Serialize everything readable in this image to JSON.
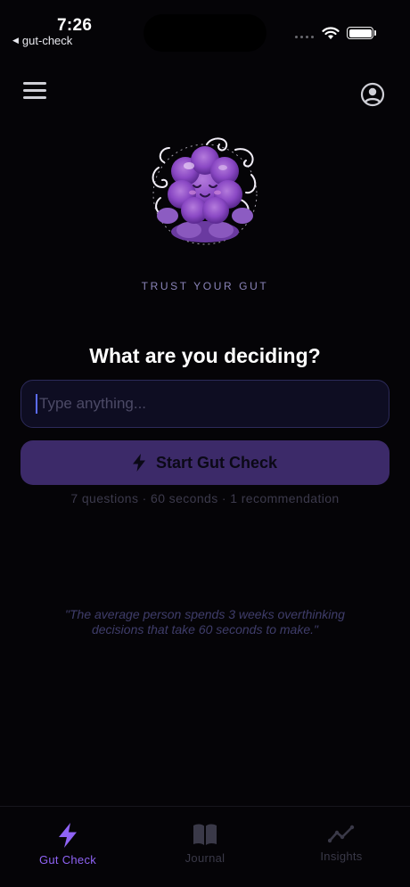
{
  "status_bar": {
    "time": "7:26",
    "back_app": "gut-check"
  },
  "header": {
    "menu_icon": "hamburger-menu-icon",
    "profile_icon": "user-profile-icon"
  },
  "hero": {
    "mascot": "meditating-purple-blob-mascot",
    "tagline": "TRUST YOUR GUT",
    "heading": "What are you deciding?"
  },
  "decision_input": {
    "value": "",
    "placeholder": "Type anything..."
  },
  "start_button": {
    "icon": "lightning-bolt-icon",
    "label": "Start Gut Check"
  },
  "meta": "7 questions · 60 seconds · 1 recommendation",
  "quote": "\"The average person spends 3 weeks overthinking decisions that take 60 seconds to make.\"",
  "tab_bar": {
    "tabs": [
      {
        "label": "Gut Check",
        "icon": "lightning-bolt-icon",
        "active": true
      },
      {
        "label": "Journal",
        "icon": "open-book-icon",
        "active": false
      },
      {
        "label": "Insights",
        "icon": "trend-line-icon",
        "active": false
      }
    ]
  },
  "colors": {
    "background": "#050407",
    "accent": "#8f63f5",
    "button": "#3c2a69",
    "input_border": "#2c2a5a"
  }
}
